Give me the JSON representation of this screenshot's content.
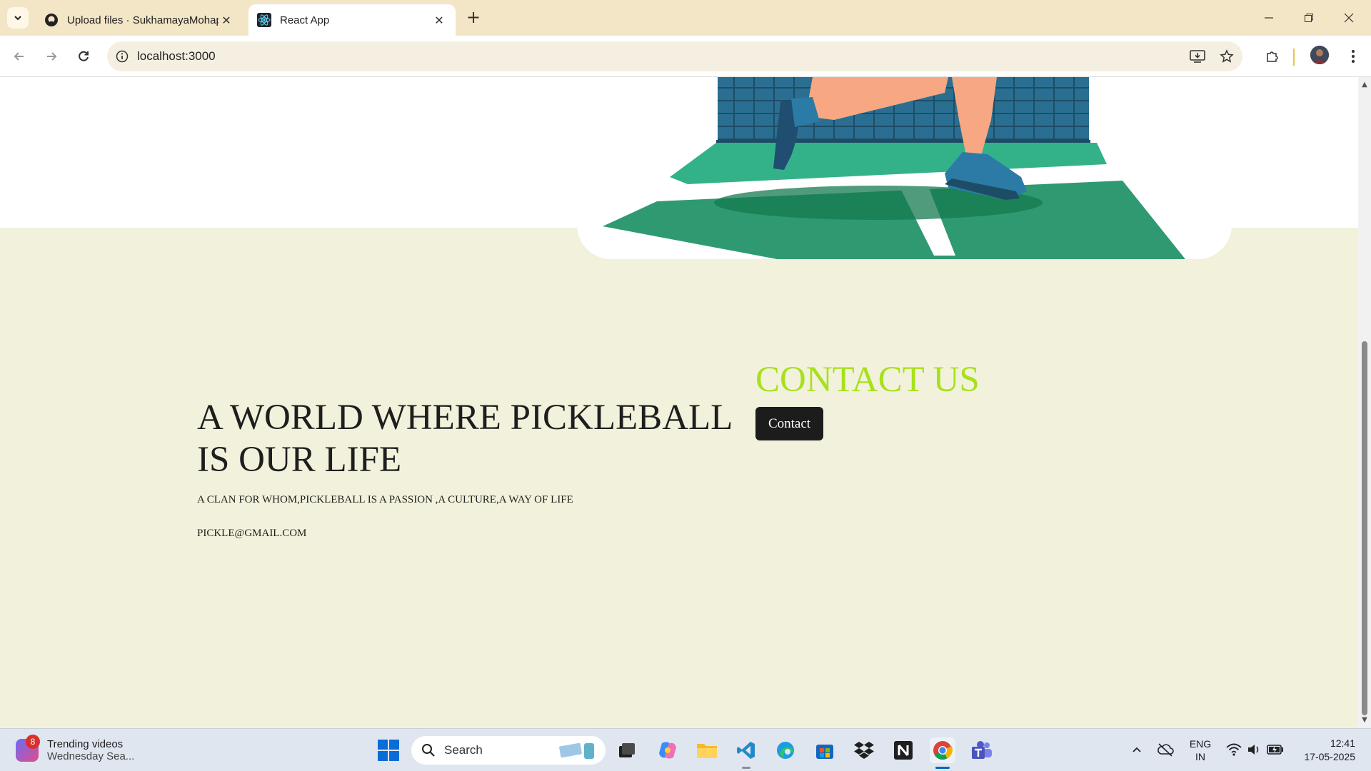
{
  "browser": {
    "tabs": [
      {
        "title": "Upload files · SukhamayaMohapatra",
        "icon": "github-icon",
        "active": false
      },
      {
        "title": "React App",
        "icon": "react-icon",
        "active": true
      }
    ],
    "url": "localhost:3000"
  },
  "page": {
    "headline_line1": "A WORLD WHERE PICKLEBALL",
    "headline_line2": "IS OUR LIFE",
    "tagline": "A CLAN FOR WHOM,PICKLEBALL IS A PASSION ,A CULTURE,A WAY OF LIFE",
    "email": "PICKLE@GMAIL.COM",
    "contact_title": "CONTACT US",
    "contact_button": "Contact",
    "colors": {
      "background": "#f2f2dc",
      "accent": "#a8e01c",
      "button": "#1c1c1c",
      "court_green": "#2f9a72",
      "net_blue": "#2e7fa8"
    }
  },
  "taskbar": {
    "widget_title": "Trending videos",
    "widget_subtitle": "Wednesday Sea...",
    "widget_badge": "8",
    "search_placeholder": "Search",
    "lang_line1": "ENG",
    "lang_line2": "IN",
    "time": "12:41",
    "date": "17-05-2025"
  }
}
